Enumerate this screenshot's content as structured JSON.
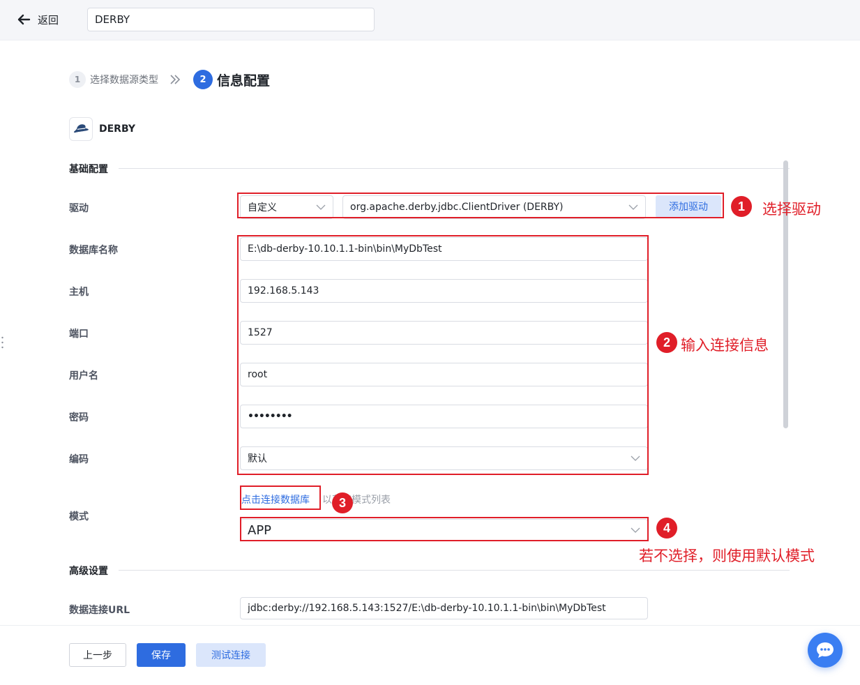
{
  "topbar": {
    "back_label": "返回",
    "name_value": "DERBY"
  },
  "steps": [
    {
      "num": "1",
      "label": "选择数据源类型"
    },
    {
      "num": "2",
      "label": "信息配置"
    }
  ],
  "datasource": {
    "title": "DERBY",
    "logo_icon": "derby-hat-icon"
  },
  "sections": {
    "basic": "基础配置",
    "advanced": "高级设置"
  },
  "form": {
    "driver": {
      "label": "驱动",
      "type_value": "自定义",
      "class_value": "org.apache.derby.jdbc.ClientDriver (DERBY)",
      "add_label": "添加驱动"
    },
    "database": {
      "label": "数据库名称",
      "value": "E:\\db-derby-10.10.1.1-bin\\bin\\MyDbTest"
    },
    "host": {
      "label": "主机",
      "value": "192.168.5.143"
    },
    "port": {
      "label": "端口",
      "value": "1527"
    },
    "username": {
      "label": "用户名",
      "value": "root"
    },
    "password": {
      "label": "密码",
      "value": "••••••••"
    },
    "encoding": {
      "label": "编码",
      "value": "默认"
    },
    "schema": {
      "label": "模式",
      "link": "点击连接数据库",
      "hint": "以获取模式列表",
      "value": "APP"
    },
    "url": {
      "label": "数据连接URL",
      "value": "jdbc:derby://192.168.5.143:1527/E:\\db-derby-10.10.1.1-bin\\bin\\MyDbTest"
    }
  },
  "annotations": [
    {
      "num": "1",
      "text": "选择驱动"
    },
    {
      "num": "2",
      "text": "输入连接信息"
    },
    {
      "num": "3",
      "text": ""
    },
    {
      "num": "4",
      "text": "若不选择，则使用默认模式"
    }
  ],
  "footer": {
    "prev": "上一步",
    "save": "保存",
    "test": "测试连接"
  },
  "colors": {
    "primary": "#2e6ce0",
    "annotation_red": "#e01e28",
    "light_blue": "#dbe6fb"
  }
}
